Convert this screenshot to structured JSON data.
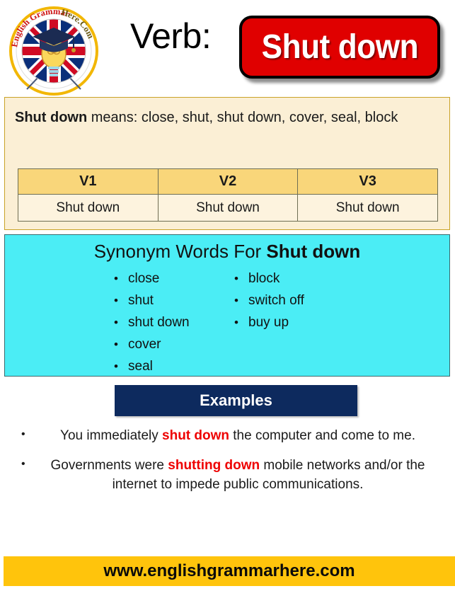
{
  "header": {
    "logo_text_top": "English Grammar Here",
    "logo_text_end": ".Com",
    "logo_alt": "english-grammar-here-logo",
    "verb_label": "Verb:",
    "verb_word": "Shut down"
  },
  "definition": {
    "term": "Shut down",
    "connector": " means: ",
    "meanings": "close, shut, shut down, cover, seal, block",
    "full_text": "Shut down means: close, shut, shut down, cover, seal, block"
  },
  "forms_table": {
    "headers": [
      "V1",
      "V2",
      "V3"
    ],
    "row": [
      "Shut down",
      "Shut down",
      "Shut down"
    ]
  },
  "synonyms": {
    "title_prefix": "Synonym Words For ",
    "title_term": "Shut down",
    "column_left": [
      "close",
      "shut",
      "shut down",
      "cover",
      "seal"
    ],
    "column_right": [
      "block",
      "switch off",
      "buy up"
    ]
  },
  "examples": {
    "banner_label": "Examples",
    "items": [
      {
        "before": "You immediately ",
        "highlight": "shut down",
        "after": " the computer and come to me."
      },
      {
        "before": " Governments were ",
        "highlight": "shutting down",
        "after": " mobile networks and/or the internet to impede public communications."
      }
    ]
  },
  "footer": {
    "url": "www.englishgrammarhere.com"
  },
  "colors": {
    "verb_box_red": "#E00000",
    "definition_bg": "#FBEFD5",
    "table_header_bg": "#F9D67A",
    "table_cell_bg": "#FDF3DE",
    "synonym_bg": "#4BEDF5",
    "examples_banner_navy": "#0D2A5E",
    "highlight_red": "#EE0000",
    "footer_yellow": "#FFC40C"
  }
}
